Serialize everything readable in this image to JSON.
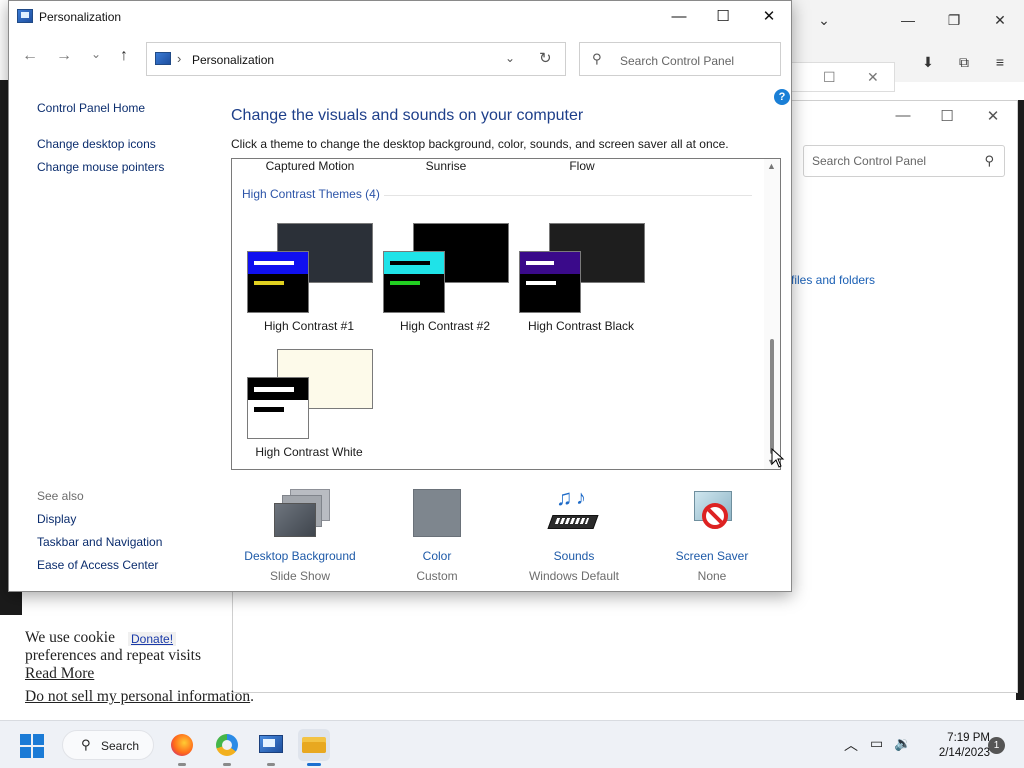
{
  "window": {
    "title": "Personalization",
    "minimize": "—",
    "maximize": "☐",
    "close": "✕"
  },
  "nav": {
    "back": "←",
    "forward": "→",
    "recent": "⌄",
    "up": "↑",
    "address_chevron": "›",
    "address": "Personalization",
    "address_dropdown": "⌄",
    "refresh": "↻",
    "search_icon": "⚲",
    "search_placeholder": "Search Control Panel"
  },
  "help": "?",
  "sidebar": {
    "home": "Control Panel Home",
    "links": [
      "Change desktop icons",
      "Change mouse pointers"
    ],
    "see_also_label": "See also",
    "see_also": [
      "Display",
      "Taskbar and Navigation",
      "Ease of Access Center"
    ]
  },
  "main": {
    "title": "Change the visuals and sounds on your computer",
    "subtitle": "Click a theme to change the desktop background, color, sounds, and screen saver all at once."
  },
  "themes": {
    "partial_top": [
      "Captured Motion",
      "Sunrise",
      "Flow"
    ],
    "group_label": "High Contrast Themes (4)",
    "items": [
      {
        "name": "High Contrast #1",
        "back": "#2b3038",
        "front_bg": "#000000",
        "header": "#1010f0",
        "bar1": "#ffffff",
        "bar2": "#e0d020"
      },
      {
        "name": "High Contrast #2",
        "back": "#000000",
        "front_bg": "#000000",
        "header": "#1fe3e8",
        "bar1": "#000000",
        "bar2": "#22d022"
      },
      {
        "name": "High Contrast Black",
        "back": "#1e1e1e",
        "front_bg": "#000000",
        "header": "#3a0a8a",
        "bar1": "#ffffff",
        "bar2": "#ffffff"
      },
      {
        "name": "High Contrast White",
        "back": "#fdfaea",
        "front_bg": "#ffffff",
        "header": "#000000",
        "bar1": "#ffffff",
        "bar2": "#000000"
      }
    ]
  },
  "bottom": [
    {
      "label": "Desktop Background",
      "value": "Slide Show",
      "icon": "desktop-background-icon"
    },
    {
      "label": "Color",
      "value": "Custom",
      "icon": "color-swatch-icon"
    },
    {
      "label": "Sounds",
      "value": "Windows Default",
      "icon": "music-notes-icon"
    },
    {
      "label": "Screen Saver",
      "value": "None",
      "icon": "screen-saver-icon"
    }
  ],
  "background": {
    "search_placeholder": "Search Control Panel",
    "link": "files and folders",
    "cookie_line1": "We use cookie",
    "cookie_line2": "preferences and repeat visits",
    "read_more": "Read More",
    "do_not_sell": "Do not sell my personal information",
    "period": ".",
    "donate": "Donate!",
    "browser_buttons": [
      "⌄",
      "—",
      "❐",
      "✕"
    ],
    "toolbar_icons": [
      "⬇",
      "⧉",
      "≡"
    ],
    "win2_buttons": [
      "—",
      "☐",
      "✕"
    ]
  },
  "taskbar": {
    "search_label": "Search",
    "search_icon": "⚲",
    "tray_chevron": "︿",
    "time": "7:19 PM",
    "date": "2/14/2023",
    "notifications": "1"
  }
}
